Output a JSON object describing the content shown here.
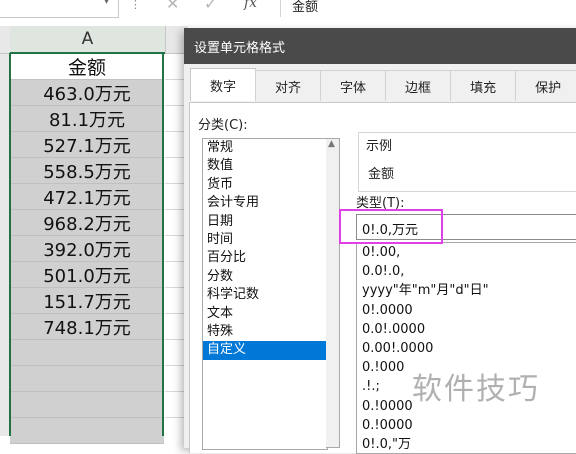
{
  "formula_bar": {
    "dropdown_glyph": "▾",
    "more_glyph": "⋮",
    "cancel_glyph": "✕",
    "confirm_glyph": "✓",
    "fx_label": "fx",
    "content": "金额"
  },
  "sheet": {
    "column_header": "A",
    "header_cell": "金额",
    "values": [
      "463.0万元",
      "81.1万元",
      "527.1万元",
      "558.5万元",
      "472.1万元",
      "968.2万元",
      "392.0万元",
      "501.0万元",
      "151.7万元",
      "748.1万元"
    ]
  },
  "dialog": {
    "title": "设置单元格格式",
    "tabs": [
      "数字",
      "对齐",
      "字体",
      "边框",
      "填充",
      "保护"
    ],
    "active_tab": "数字",
    "category_label": "分类(C):",
    "categories": [
      "常规",
      "数值",
      "货币",
      "会计专用",
      "日期",
      "时间",
      "百分比",
      "分数",
      "科学记数",
      "文本",
      "特殊",
      "自定义"
    ],
    "selected_category": "自定义",
    "sample_label": "示例",
    "sample_value": "金额",
    "type_label": "类型(T):",
    "type_value": "0!.0,万元",
    "format_list": [
      "0!.00,",
      "0.0!.0,",
      "yyyy\"年\"m\"月\"d\"日\"",
      "0!.0000",
      "0.0!.0000",
      "0.00!.0000",
      "0.!000",
      ".!.;",
      "0.!0000",
      "0.!0000",
      "0!.0,\"万"
    ]
  },
  "watermark": "软件技巧",
  "colors": {
    "accent_green": "#217346",
    "highlight_magenta": "#e040e8",
    "selection_blue": "#0078d7",
    "titlebar": "#4a4a4a"
  }
}
